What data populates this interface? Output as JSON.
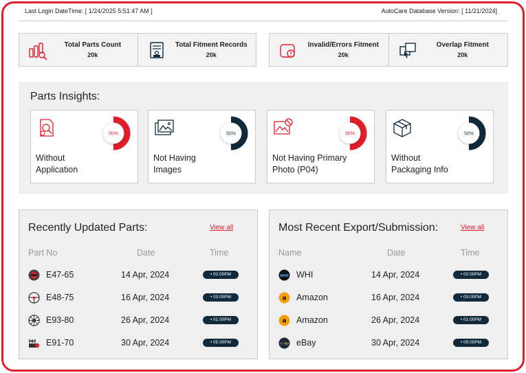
{
  "header": {
    "last_login": "Last Login DateTime: [ 1/24/2025 5:51:47 AM ]",
    "db_version": "AutoCare Database Version: [ 11/21/2024]"
  },
  "stats": [
    {
      "label": "Total Parts Count",
      "value": "20k",
      "icon": "parts-count-icon"
    },
    {
      "label": "Total Fitment Records",
      "value": "20k",
      "icon": "fitment-records-icon"
    },
    {
      "label": "Invalid/Errors Fitment",
      "value": "20k",
      "icon": "error-fitment-icon"
    },
    {
      "label": "Overlap Fitment",
      "value": "20k",
      "icon": "overlap-fitment-icon"
    }
  ],
  "insights": {
    "title": "Parts Insights:",
    "cards": [
      {
        "line1": "Without",
        "line2": "Application",
        "percent": "50%",
        "value": 50,
        "color": "#e11d2a"
      },
      {
        "line1": "Not Having",
        "line2": "Images",
        "percent": "50%",
        "value": 50,
        "color": "#102a3c"
      },
      {
        "line1": "Not Having Primary",
        "line2": "Photo (P04)",
        "percent": "50%",
        "value": 50,
        "color": "#e11d2a"
      },
      {
        "line1": "Without",
        "line2": "Packaging Info",
        "percent": "50%",
        "value": 50,
        "color": "#102a3c"
      }
    ]
  },
  "recent_parts": {
    "title": "Recently Updated Parts:",
    "view_all": "View all",
    "columns": [
      "Part No",
      "Date",
      "Time"
    ],
    "rows": [
      {
        "name": "E47-65",
        "date": "14 Apr, 2024",
        "time": "02:00PM",
        "icon": "brake-part-icon"
      },
      {
        "name": "E48-75",
        "date": "16 Apr, 2024",
        "time": "03:00PM",
        "icon": "steering-wheel-icon"
      },
      {
        "name": "E93-80",
        "date": "26 Apr, 2024",
        "time": "01:00PM",
        "icon": "wheel-rim-icon"
      },
      {
        "name": "E91-70",
        "date": "30 Apr, 2024",
        "time": "05:00PM",
        "icon": "gear-box-icon"
      }
    ]
  },
  "recent_exports": {
    "title": "Most Recent Export/Submission:",
    "view_all": "View all",
    "columns": [
      "Name",
      "Date",
      "Time"
    ],
    "rows": [
      {
        "name": "WHI",
        "date": "14 Apr, 2024",
        "time": "02:00PM",
        "icon": "whi-logo-icon"
      },
      {
        "name": "Amazon",
        "date": "16 Apr, 2024",
        "time": "03:00PM",
        "icon": "amazon-logo-icon"
      },
      {
        "name": "Amazon",
        "date": "26 Apr, 2024",
        "time": "01:00PM",
        "icon": "amazon-logo-icon"
      },
      {
        "name": "eBay",
        "date": "30 Apr, 2024",
        "time": "05:00PM",
        "icon": "ebay-logo-icon"
      }
    ]
  },
  "colors": {
    "accent": "#e11d2a",
    "navy": "#102a3c"
  }
}
